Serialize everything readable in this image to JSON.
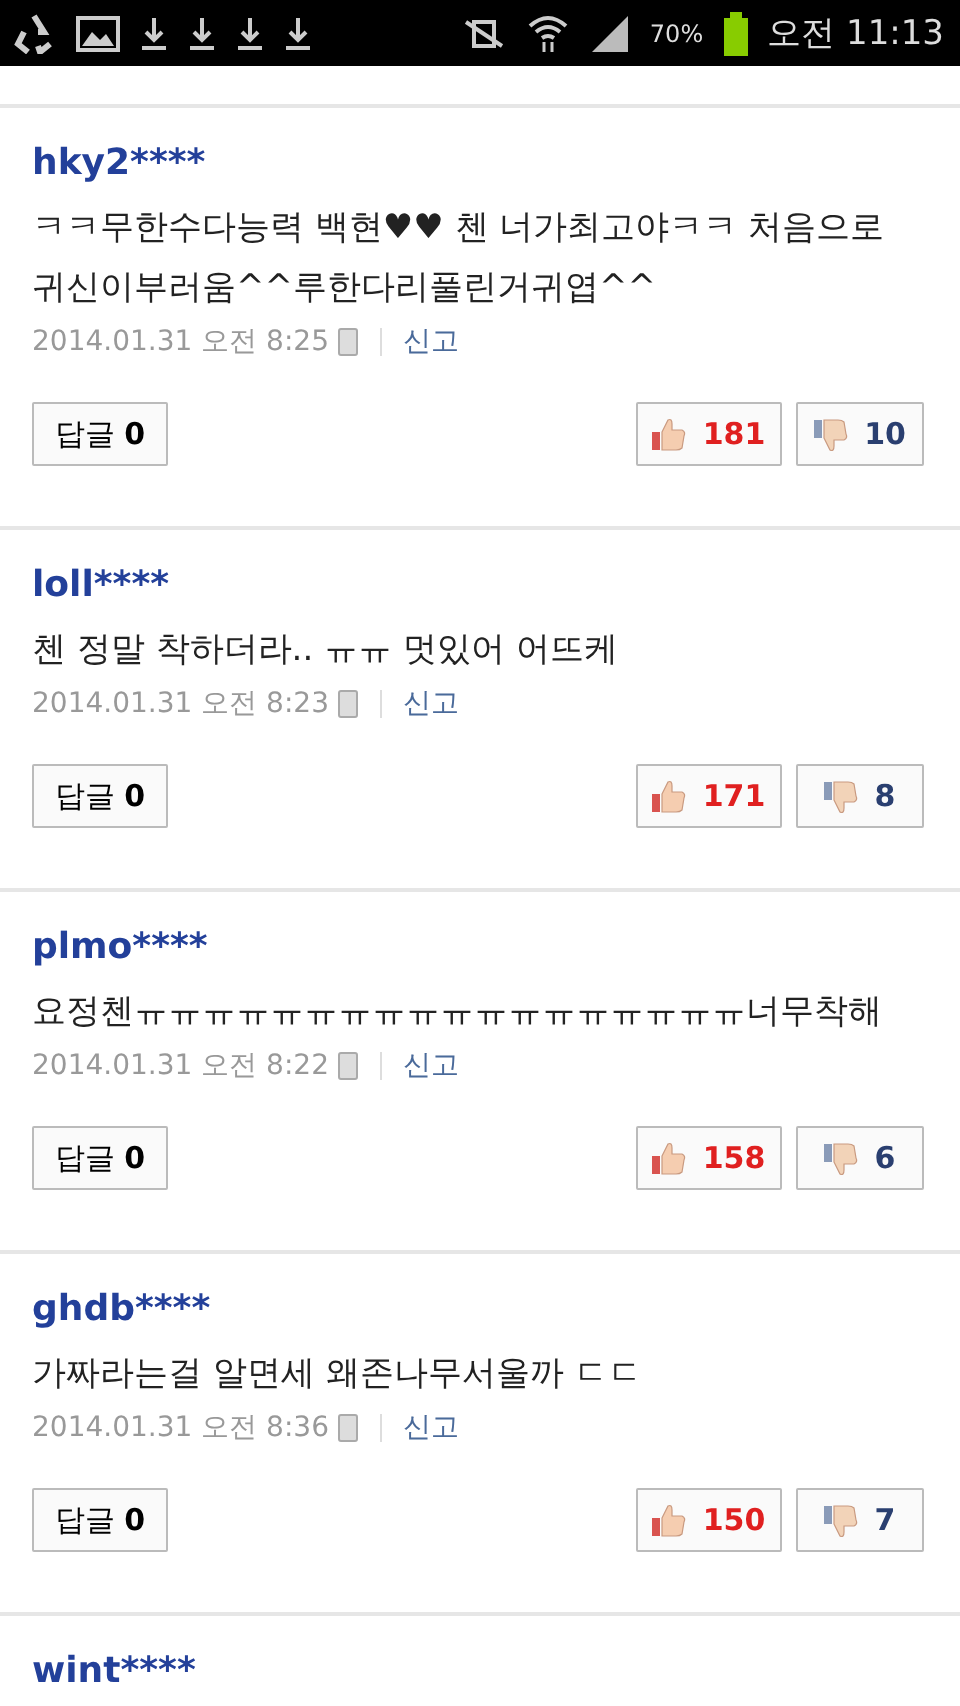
{
  "status_bar": {
    "battery": "70%",
    "clock": "오전 11:13"
  },
  "comments": [
    {
      "user": "hky2****",
      "text": "ㅋㅋ무한수다능력 백현♥♥ 첸 너가최고야ㅋㅋ 처음으로 귀신이부러움^^루한다리풀린거귀엽^^",
      "date": "2014.01.31 오전 8:25",
      "report": "신고",
      "reply": "답글 **0**",
      "likes": "181",
      "dislikes": "10"
    },
    {
      "user": "loll****",
      "text": "첸 정말 착하더라.. ㅠㅠ 멋있어 어뜨케",
      "date": "2014.01.31 오전 8:23",
      "report": "신고",
      "reply": "답글 **0**",
      "likes": "171",
      "dislikes": "8"
    },
    {
      "user": "plmo****",
      "text": "요정첸ㅠㅠㅠㅠㅠㅠㅠㅠㅠㅠㅠㅠㅠㅠㅠㅠㅠㅠ너무착해",
      "date": "2014.01.31 오전 8:22",
      "report": "신고",
      "reply": "답글 **0**",
      "likes": "158",
      "dislikes": "6"
    },
    {
      "user": "ghdb****",
      "text": "가짜라는걸 알면세 왜존나무서울까 ㄷㄷ",
      "date": "2014.01.31 오전 8:36",
      "report": "신고",
      "reply": "답글 **0**",
      "likes": "150",
      "dislikes": "7"
    },
    {
      "user": "wint****"
    }
  ]
}
